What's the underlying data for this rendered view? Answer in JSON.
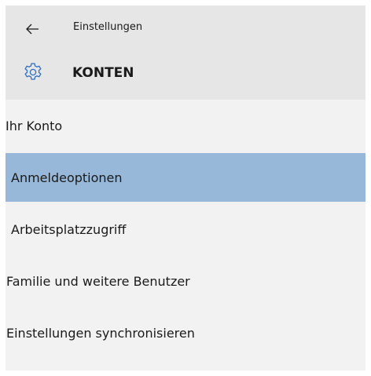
{
  "header": {
    "back_label": "Zurück",
    "app_title": "Einstellungen",
    "section_title": "KONTEN",
    "section_icon": "gear-icon"
  },
  "nav": {
    "items": [
      {
        "label": "Ihr Konto",
        "selected": false
      },
      {
        "label": "Anmeldeoptionen",
        "selected": true
      },
      {
        "label": "Arbeitsplatzzugriff",
        "selected": false
      },
      {
        "label": "Familie und weitere Benutzer",
        "selected": false
      },
      {
        "label": "Einstellungen synchronisieren",
        "selected": false
      }
    ]
  },
  "colors": {
    "header_bg": "#e6e6e6",
    "panel_bg": "#f2f2f2",
    "selected_bg": "#97b8d8",
    "accent": "#3a7dc9"
  }
}
